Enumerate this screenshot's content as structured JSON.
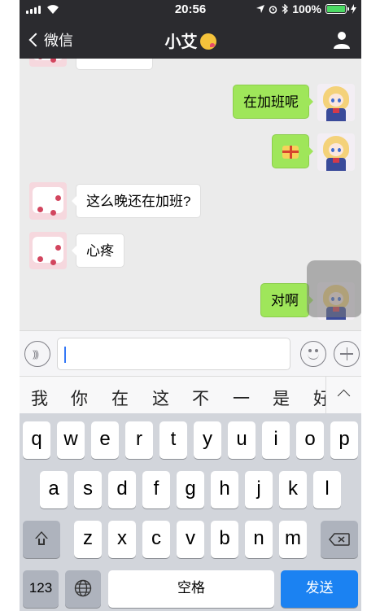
{
  "status_bar": {
    "time": "20:56",
    "battery": "100%"
  },
  "nav": {
    "back_label": "微信",
    "title": "小艾"
  },
  "messages": [
    {
      "side": "right",
      "text": "在加班呢"
    },
    {
      "side": "right",
      "text": ""
    },
    {
      "side": "left",
      "text": "这么晚还在加班?"
    },
    {
      "side": "left",
      "text": "心疼"
    },
    {
      "side": "right",
      "text": "对啊"
    }
  ],
  "input": {
    "value": ""
  },
  "candidates": [
    "我",
    "你",
    "在",
    "这",
    "不",
    "一",
    "是",
    "好"
  ],
  "keyboard": {
    "row1": [
      "q",
      "w",
      "e",
      "r",
      "t",
      "y",
      "u",
      "i",
      "o",
      "p"
    ],
    "row2": [
      "a",
      "s",
      "d",
      "f",
      "g",
      "h",
      "j",
      "k",
      "l"
    ],
    "row3": [
      "z",
      "x",
      "c",
      "v",
      "b",
      "n",
      "m"
    ],
    "numbers_key": "123",
    "space_key": "空格",
    "send_key": "发送"
  },
  "colors": {
    "nav_bg": "#2b2b2f",
    "chat_bg": "#ebebeb",
    "sent_bubble": "#9fe65a",
    "received_bubble": "#ffffff",
    "send_key": "#1b82f2",
    "battery": "#4cd964"
  }
}
